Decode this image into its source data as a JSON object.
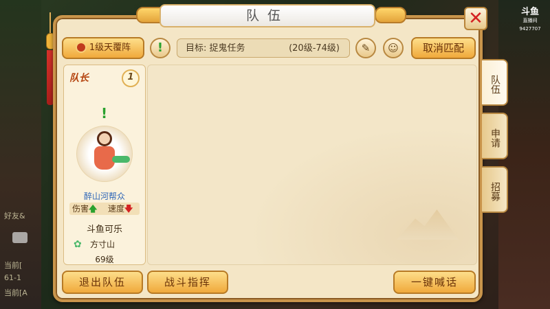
{
  "background": {
    "lines": [
      "好友&",
      "当前[",
      "61-1",
      "当前[A"
    ]
  },
  "stream_logo": {
    "brand": "斗鱼",
    "sub": "直播间",
    "room": "9427707"
  },
  "window": {
    "title": "队伍",
    "close_icon": "close-x-icon"
  },
  "toolbar": {
    "formation_label": "1级天覆阵",
    "alert_symbol": "!",
    "target_prefix": "目标:",
    "target_task": "捉鬼任务",
    "target_range": "(20级-74级)",
    "edit_icon": "edit-icon",
    "npc_icon": "npc-icon",
    "cancel_match_label": "取消匹配"
  },
  "member": {
    "role_label": "队长",
    "slot_number": "1",
    "alert_symbol": "!",
    "sect_title": "醉山河帮众",
    "stat1": "伤害",
    "stat2": "速度",
    "up_arrow": "🡅",
    "down_arrow": "🡇",
    "name": "斗鱼可乐",
    "school_icon": "✿",
    "school": "方寸山",
    "level": "69级"
  },
  "tabs": [
    {
      "label": "队伍",
      "active": true
    },
    {
      "label": "申请",
      "active": false
    },
    {
      "label": "招募",
      "active": false
    }
  ],
  "bottom": {
    "exit_label": "退出队伍",
    "battle_label": "战斗指挥",
    "shout_label": "一键喊话"
  },
  "colors": {
    "accent_gold": "#f0a93b",
    "panel_bg": "#f4e6c6",
    "close_red": "#d42222",
    "sect_blue": "#2e66b8"
  }
}
